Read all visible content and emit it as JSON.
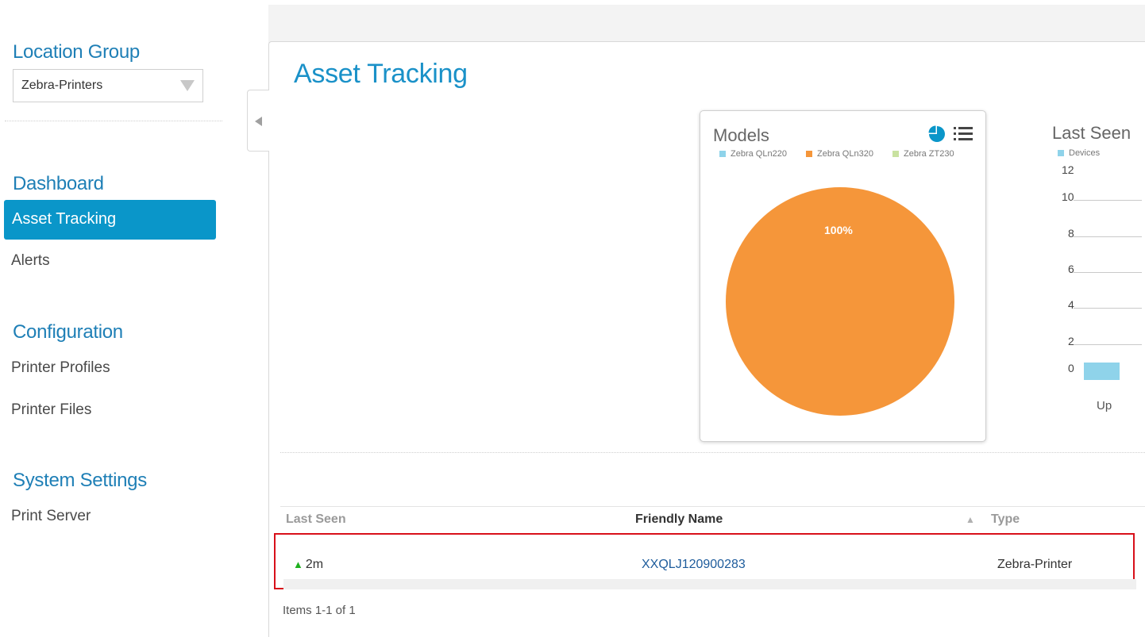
{
  "sidebar": {
    "location_group_title": "Location Group",
    "location_group_value": "Zebra-Printers",
    "dashboard_title": "Dashboard",
    "dashboard_items": [
      "Asset Tracking",
      "Alerts"
    ],
    "configuration_title": "Configuration",
    "configuration_items": [
      "Printer Profiles",
      "Printer Files"
    ],
    "system_title": "System Settings",
    "system_items": [
      "Print Server"
    ]
  },
  "main": {
    "title": "Asset Tracking"
  },
  "models_widget": {
    "title": "Models",
    "pie_label": "100%"
  },
  "last_seen_widget": {
    "title": "Last Seen",
    "legend": "Devices",
    "y_ticks": [
      "12",
      "10",
      "8",
      "6",
      "4",
      "2",
      "0"
    ],
    "category": "Up"
  },
  "chart_data": [
    {
      "type": "pie",
      "title": "Models",
      "categories": [
        "Zebra QLn220",
        "Zebra QLn320",
        "Zebra ZT230"
      ],
      "values": [
        0,
        100,
        0
      ],
      "colors": [
        "#8fd3ea",
        "#f5963a",
        "#c9e2a0"
      ],
      "data_labels": [
        "",
        "100%",
        ""
      ],
      "legend": "top"
    },
    {
      "type": "bar",
      "title": "Last Seen",
      "categories": [
        "Up"
      ],
      "series": [
        {
          "name": "Devices",
          "values": [
            1
          ]
        }
      ],
      "ylim": [
        0,
        12
      ],
      "y_ticks": [
        0,
        2,
        4,
        6,
        8,
        10,
        12
      ],
      "color": "#8fd3ea"
    }
  ],
  "table": {
    "columns": [
      "Last Seen",
      "Friendly Name",
      "Type"
    ],
    "sort_indicator": "▲",
    "rows": [
      {
        "last_seen": "2m",
        "friendly_name": "XXQLJ120900283",
        "type": "Zebra-Printer"
      }
    ],
    "footer": "Items 1-1 of 1"
  },
  "colors": {
    "accent": "#0a96c9",
    "title_blue": "#1a91c8",
    "highlight_border": "#d8101a",
    "up_green": "#1fb01f"
  },
  "icons": [
    "dropdown-caret-icon",
    "collapse-arrow-icon",
    "pie-chart-icon",
    "list-icon",
    "up-arrow-icon",
    "sort-asc-icon"
  ]
}
